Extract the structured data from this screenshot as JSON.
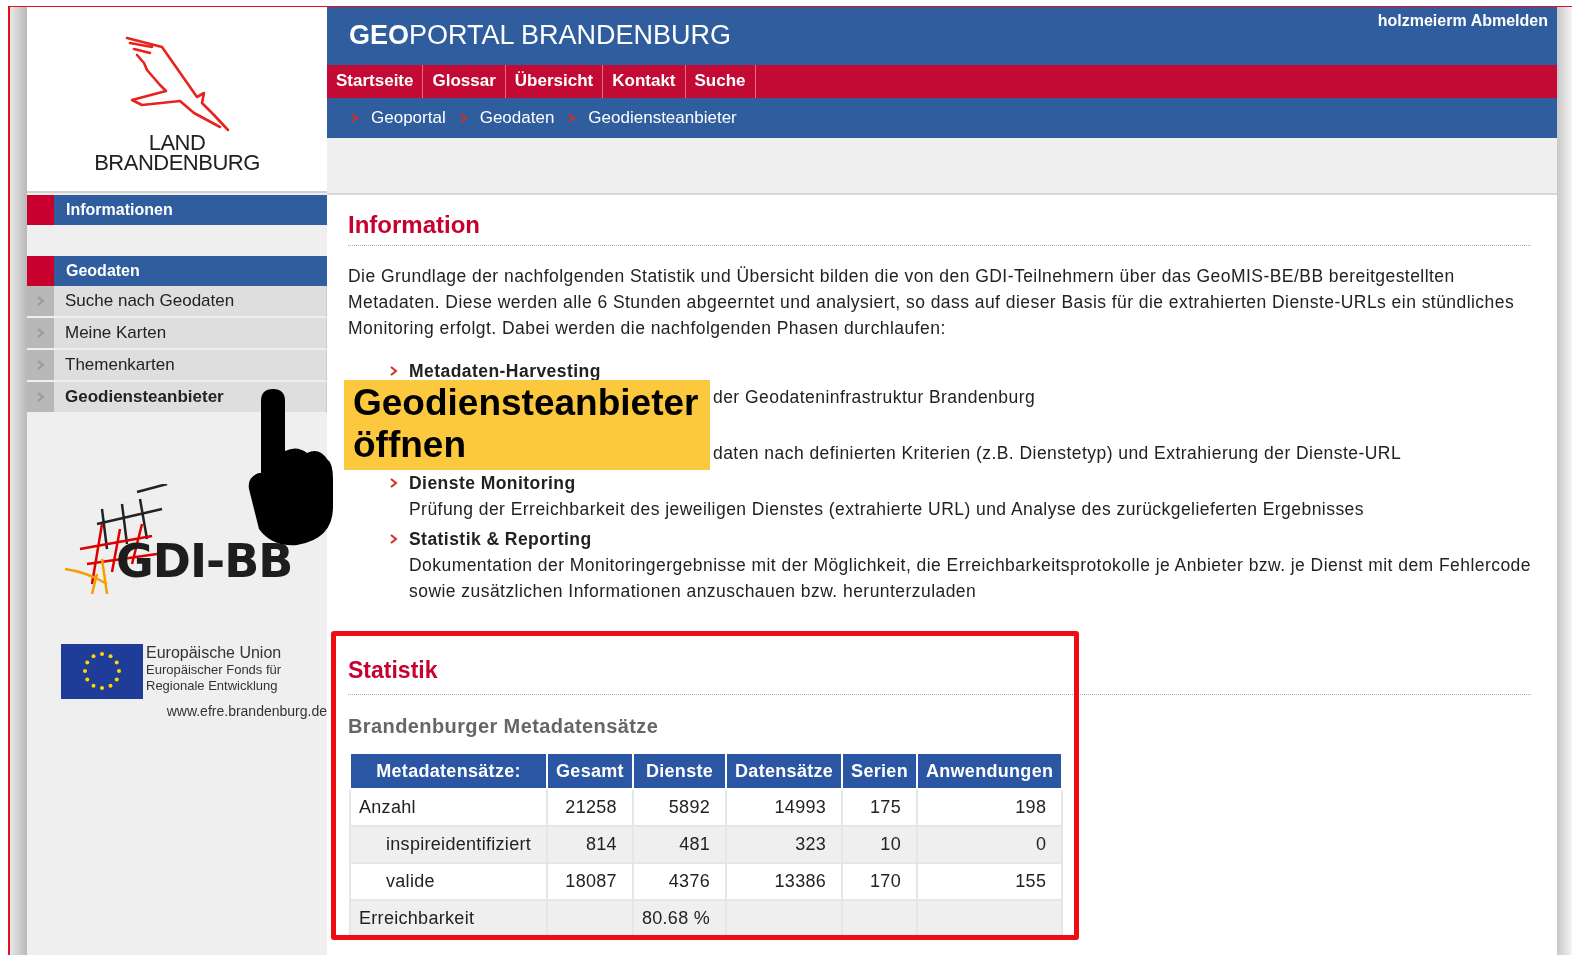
{
  "header": {
    "logo_lines": [
      "LAND",
      "BRANDENBURG"
    ],
    "title_bold": "GEO",
    "title_rest": "PORTAL BRANDENBURG",
    "user": "holzmeierm",
    "logout": "Abmelden"
  },
  "nav": [
    {
      "label": "Startseite"
    },
    {
      "label": "Glossar"
    },
    {
      "label": "Übersicht"
    },
    {
      "label": "Kontakt"
    },
    {
      "label": "Suche"
    }
  ],
  "breadcrumb": [
    "Geoportal",
    "Geodaten",
    "Geodiensteanbieter"
  ],
  "sidebar": {
    "sections": [
      {
        "title": "Informationen"
      },
      {
        "title": "Geodaten",
        "items": [
          {
            "label": "Suche nach Geodaten",
            "selected": false
          },
          {
            "label": "Meine Karten",
            "selected": false
          },
          {
            "label": "Themenkarten",
            "selected": false
          },
          {
            "label": "Geodiensteanbieter",
            "selected": true
          }
        ]
      }
    ]
  },
  "gdi_logo": {
    "text": "GDI-BB"
  },
  "eu_logo": {
    "lines": [
      "Europäische Union",
      "Europäischer Fonds für",
      "Regionale Entwicklung"
    ],
    "url": "www.efre.brandenburg.de"
  },
  "information": {
    "heading": "Information",
    "intro": "Die Grundlage der nachfolgenden Statistik und Übersicht bilden die von den GDI-Teilnehmern über das GeoMIS-BE/BB bereitgestellten Metadaten. Diese werden alle 6 Stunden abgeerntet und analysiert, so dass auf dieser Basis für die extrahierten Dienste-URLs ein stündliches Monitoring erfolgt. Dabei werden die nachfolgenden Phasen durchlaufen:",
    "phases": [
      {
        "title": "Metadaten-Harvesting",
        "description": "der Geodateninfrastruktur Brandenburg",
        "covered": true
      },
      {
        "description": "daten nach definierten Kriterien (z.B. Dienstetyp) und Extrahierung der Dienste-URL",
        "covered": true
      },
      {
        "title": "Dienste Monitoring",
        "description": "Prüfung der Erreichbarkeit des jeweiligen Dienstes (extrahierte URL) und Analyse des zurückgelieferten Ergebnisses"
      },
      {
        "title": "Statistik & Reporting",
        "description": "Dokumentation der Monitoringergebnisse mit der Möglichkeit, die Erreichbarkeitsprotokolle je Anbieter bzw. je Dienst mit dem Fehlercode sowie zusätzlichen Informationen anzuschauen bzw. herunterzuladen"
      }
    ]
  },
  "callout": {
    "text": "Geodiensteanbieter öffnen"
  },
  "statistik": {
    "heading": "Statistik",
    "subheading": "Brandenburger Metadatensätze",
    "table": {
      "columns": [
        "Metadatensätze:",
        "Gesamt",
        "Dienste",
        "Datensätze",
        "Serien",
        "Anwendungen"
      ],
      "rows": [
        {
          "label": "Anzahl",
          "values": [
            "21258",
            "5892",
            "14993",
            "175",
            "198"
          ],
          "children": [
            {
              "label": "inspireidentifiziert",
              "values": [
                "814",
                "481",
                "323",
                "10",
                "0"
              ]
            },
            {
              "label": "valide",
              "values": [
                "18087",
                "4376",
                "13386",
                "170",
                "155"
              ]
            }
          ]
        },
        {
          "label": "Erreichbarkeit",
          "values": [
            {
              "empty": true
            },
            {
              "text": "80.68 %"
            },
            {
              "empty": true
            },
            {
              "empty": true
            },
            {
              "empty": true
            }
          ]
        }
      ]
    }
  }
}
